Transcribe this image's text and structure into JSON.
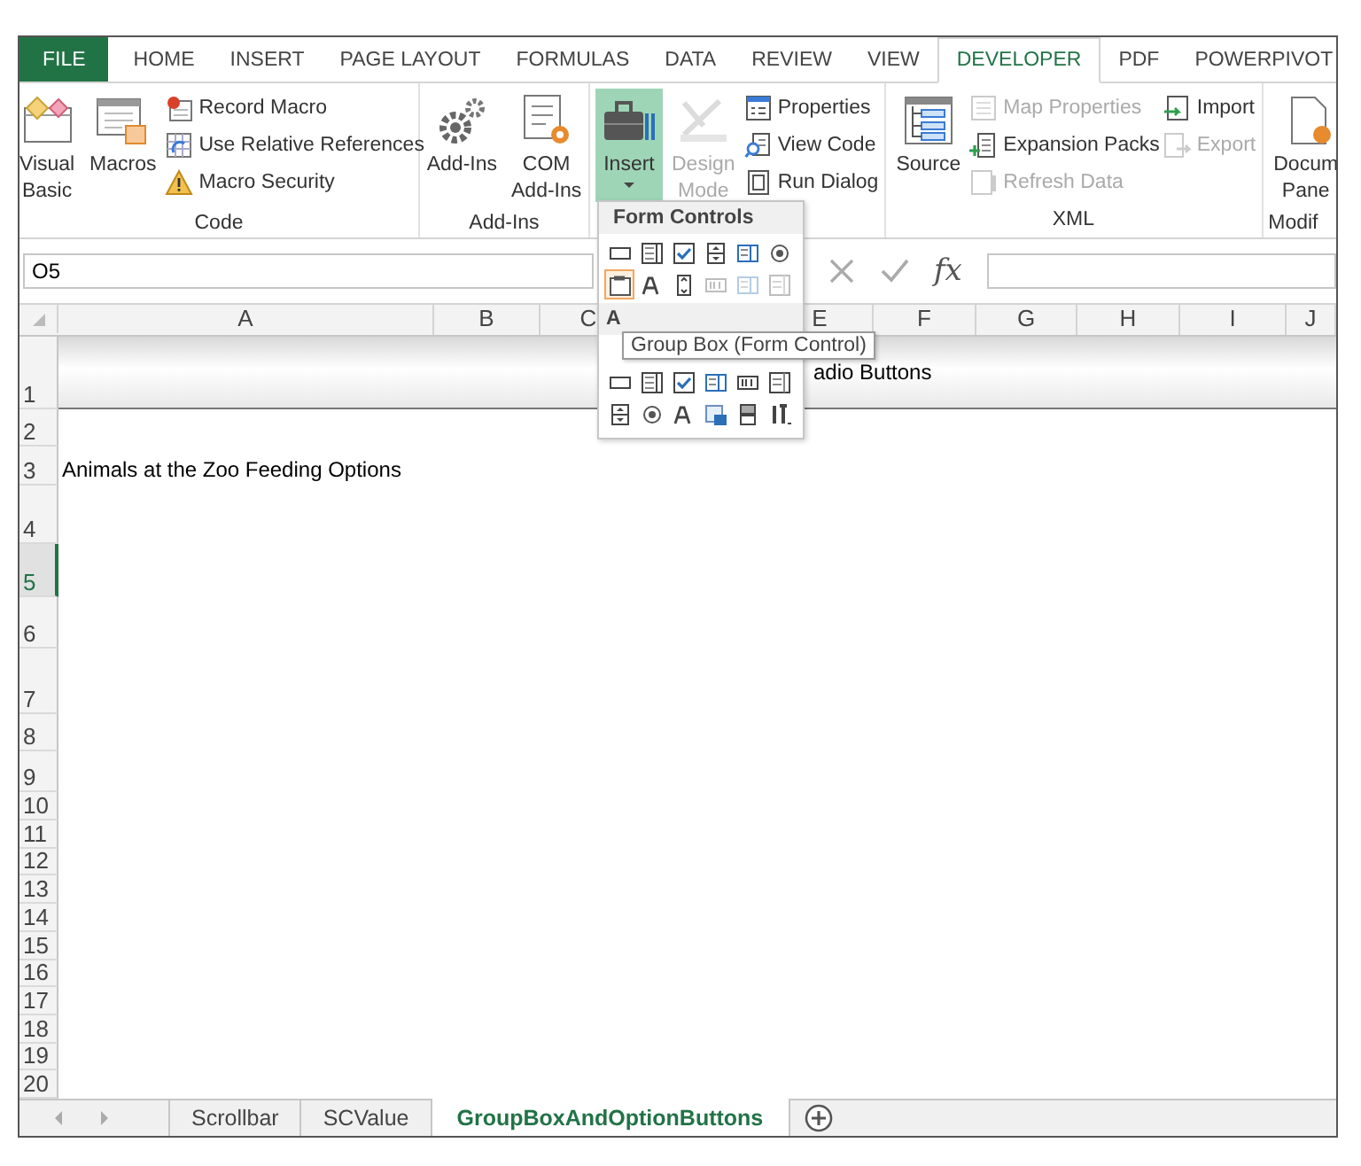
{
  "tabs": [
    {
      "label": "FILE",
      "kind": "file",
      "selected": false
    },
    {
      "label": "HOME",
      "kind": "tab",
      "selected": false
    },
    {
      "label": "INSERT",
      "kind": "tab",
      "selected": false
    },
    {
      "label": "PAGE LAYOUT",
      "kind": "tab",
      "selected": false
    },
    {
      "label": "FORMULAS",
      "kind": "tab",
      "selected": false
    },
    {
      "label": "DATA",
      "kind": "tab",
      "selected": false
    },
    {
      "label": "REVIEW",
      "kind": "tab",
      "selected": false
    },
    {
      "label": "VIEW",
      "kind": "tab",
      "selected": false
    },
    {
      "label": "DEVELOPER",
      "kind": "tab",
      "selected": true
    },
    {
      "label": "PDF",
      "kind": "tab",
      "selected": false
    },
    {
      "label": "POWERPIVOT",
      "kind": "tab",
      "selected": false
    }
  ],
  "ribbon": {
    "groups": [
      {
        "label": "Code",
        "columns": [
          {
            "kind": "large",
            "items": [
              {
                "label": "Visual\nBasic",
                "disabled": false,
                "pressed": false
              }
            ]
          },
          {
            "kind": "large",
            "items": [
              {
                "label": "Macros",
                "disabled": false,
                "pressed": false
              }
            ]
          },
          {
            "kind": "stack",
            "items": [
              {
                "label": "Record Macro",
                "disabled": false
              },
              {
                "label": "Use Relative References",
                "disabled": false
              },
              {
                "label": "Macro Security",
                "disabled": false
              }
            ]
          }
        ]
      },
      {
        "label": "Add-Ins",
        "columns": [
          {
            "kind": "large",
            "items": [
              {
                "label": "Add-Ins",
                "disabled": false,
                "pressed": false
              }
            ]
          },
          {
            "kind": "large",
            "items": [
              {
                "label": "COM\nAdd-Ins",
                "disabled": false,
                "pressed": false
              }
            ]
          }
        ]
      },
      {
        "columns": [
          {
            "kind": "large",
            "items": [
              {
                "label": "Insert",
                "disabled": false,
                "pressed": true,
                "dropdown": true
              }
            ]
          },
          {
            "kind": "large",
            "items": [
              {
                "label": "Design\nMode",
                "disabled": true,
                "pressed": false
              }
            ]
          },
          {
            "kind": "stack",
            "items": [
              {
                "label": "Properties",
                "disabled": false
              },
              {
                "label": "View Code",
                "disabled": false
              },
              {
                "label": "Run Dialog",
                "disabled": false
              }
            ]
          }
        ]
      },
      {
        "label": "XML",
        "columns": [
          {
            "kind": "large",
            "items": [
              {
                "label": "Source",
                "disabled": false,
                "pressed": false
              }
            ]
          },
          {
            "kind": "stack",
            "items": [
              {
                "label": "Map Properties",
                "disabled": true
              },
              {
                "label": "Expansion Packs",
                "disabled": false
              },
              {
                "label": "Refresh Data",
                "disabled": true
              }
            ]
          },
          {
            "kind": "stack",
            "items": [
              {
                "label": "Import",
                "disabled": false
              },
              {
                "label": "Export",
                "disabled": true
              }
            ]
          }
        ]
      },
      {
        "label": "Modif",
        "columns": [
          {
            "kind": "large",
            "items": [
              {
                "label": "Docum\nPane",
                "disabled": false,
                "pressed": false
              }
            ]
          }
        ]
      }
    ]
  },
  "formula_bar": {
    "name_box": "O5",
    "function_button": "fx"
  },
  "columns": [
    {
      "label": "A"
    },
    {
      "label": "B"
    },
    {
      "label": "C"
    },
    {},
    {
      "label": "E"
    },
    {
      "label": "F"
    },
    {
      "label": "G"
    },
    {
      "label": "H"
    },
    {
      "label": "I"
    },
    {
      "label": "J"
    }
  ],
  "rows": [
    {
      "label": "1",
      "selected": false,
      "kind": "banner",
      "text": "adio Buttons"
    },
    {
      "label": "2",
      "selected": false
    },
    {
      "label": "3",
      "selected": false,
      "text": "Animals at the Zoo Feeding Options"
    },
    {
      "label": "4",
      "selected": false
    },
    {
      "label": "5",
      "selected": true
    },
    {
      "label": "6",
      "selected": false
    },
    {
      "label": "7",
      "selected": false
    },
    {
      "label": "8",
      "selected": false
    },
    {
      "label": "9",
      "selected": false
    },
    {
      "label": "10",
      "selected": false
    },
    {
      "label": "11",
      "selected": false
    },
    {
      "label": "12",
      "selected": false
    },
    {
      "label": "13",
      "selected": false
    },
    {
      "label": "14",
      "selected": false
    },
    {
      "label": "15",
      "selected": false
    },
    {
      "label": "16",
      "selected": false
    },
    {
      "label": "17",
      "selected": false
    },
    {
      "label": "18",
      "selected": false
    },
    {
      "label": "19",
      "selected": false
    },
    {
      "label": "20",
      "selected": false
    }
  ],
  "sheet_tabs": [
    {
      "label": "Scrollbar",
      "selected": false
    },
    {
      "label": "SCValue",
      "selected": false
    },
    {
      "label": "GroupBoxAndOptionButtons",
      "selected": true
    }
  ],
  "insert_menu": {
    "sections": [
      {
        "title": "Form Controls",
        "items": [
          {
            "disabled": false,
            "selected": false
          },
          {
            "disabled": false,
            "selected": false
          },
          {
            "disabled": false,
            "selected": false
          },
          {
            "disabled": false,
            "selected": false
          },
          {
            "disabled": false,
            "selected": false
          },
          {
            "disabled": false,
            "selected": false
          },
          {
            "disabled": false,
            "selected": true
          },
          {
            "disabled": false,
            "selected": false
          },
          {
            "disabled": false,
            "selected": false
          },
          {
            "disabled": true,
            "selected": false
          },
          {
            "disabled": true,
            "selected": false
          },
          {
            "disabled": true,
            "selected": false
          }
        ]
      },
      {
        "title": "A",
        "items": [
          {
            "disabled": false,
            "selected": false
          },
          {
            "disabled": false,
            "selected": false
          },
          {
            "disabled": false,
            "selected": false
          },
          {
            "disabled": false,
            "selected": false
          },
          {
            "disabled": false,
            "selected": false
          },
          {
            "disabled": false,
            "selected": false
          },
          {
            "disabled": false,
            "selected": false
          },
          {
            "disabled": false,
            "selected": false
          },
          {
            "disabled": false,
            "selected": false
          },
          {
            "disabled": false,
            "selected": false
          },
          {
            "disabled": false,
            "selected": false
          },
          {
            "disabled": false,
            "selected": false
          }
        ]
      }
    ],
    "tooltip": "Group Box (Form Control)"
  }
}
